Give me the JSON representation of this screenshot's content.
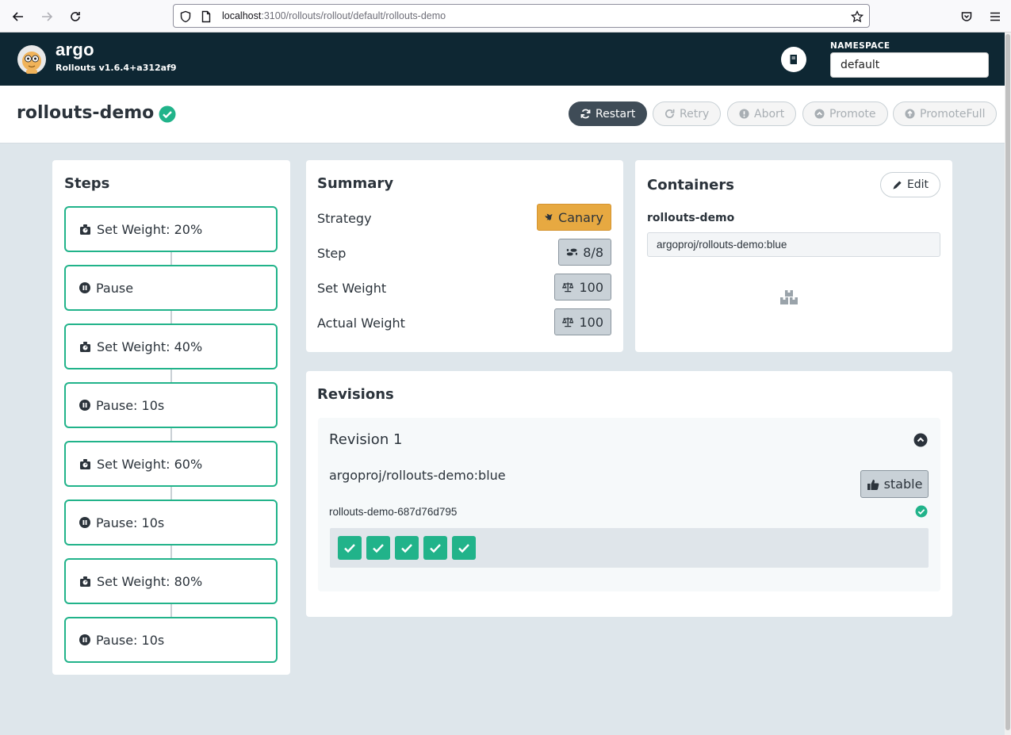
{
  "browser": {
    "url_host": "localhost",
    "url_rest": ":3100/rollouts/rollout/default/rollouts-demo"
  },
  "header": {
    "brand": "argo",
    "version": "Rollouts v1.6.4+a312af9",
    "namespace_label": "NAMESPACE",
    "namespace_value": "default"
  },
  "rollout": {
    "name": "rollouts-demo",
    "actions": [
      {
        "label": "Restart",
        "icon": "sync-icon"
      },
      {
        "label": "Retry",
        "icon": "redo-icon"
      },
      {
        "label": "Abort",
        "icon": "exclamation-circle-icon"
      },
      {
        "label": "Promote",
        "icon": "chevron-circle-up-icon"
      },
      {
        "label": "PromoteFull",
        "icon": "arrow-circle-up-icon"
      }
    ]
  },
  "steps": {
    "title": "Steps",
    "items": [
      {
        "label": "Set Weight: 20%",
        "icon": "weight-icon"
      },
      {
        "label": "Pause",
        "icon": "pause-circle-icon"
      },
      {
        "label": "Set Weight: 40%",
        "icon": "weight-icon"
      },
      {
        "label": "Pause: 10s",
        "icon": "pause-circle-icon"
      },
      {
        "label": "Set Weight: 60%",
        "icon": "weight-icon"
      },
      {
        "label": "Pause: 10s",
        "icon": "pause-circle-icon"
      },
      {
        "label": "Set Weight: 80%",
        "icon": "weight-icon"
      },
      {
        "label": "Pause: 10s",
        "icon": "pause-circle-icon"
      }
    ]
  },
  "summary": {
    "title": "Summary",
    "strategy_label": "Strategy",
    "strategy_value": "Canary",
    "step_label": "Step",
    "step_value": "8/8",
    "set_weight_label": "Set Weight",
    "set_weight_value": "100",
    "actual_weight_label": "Actual Weight",
    "actual_weight_value": "100"
  },
  "containers": {
    "title": "Containers",
    "edit_label": "Edit",
    "container_name": "rollouts-demo",
    "image": "argoproj/rollouts-demo:blue"
  },
  "revisions": {
    "title": "Revisions",
    "items": [
      {
        "title": "Revision 1",
        "image": "argoproj/rollouts-demo:blue",
        "badge": "stable",
        "replicaset": "rollouts-demo-687d76d795",
        "pods_ready": 5
      }
    ]
  },
  "colors": {
    "header_bg": "#0e2733",
    "accent_green": "#21b38a",
    "canary_orange": "#e7a941"
  }
}
